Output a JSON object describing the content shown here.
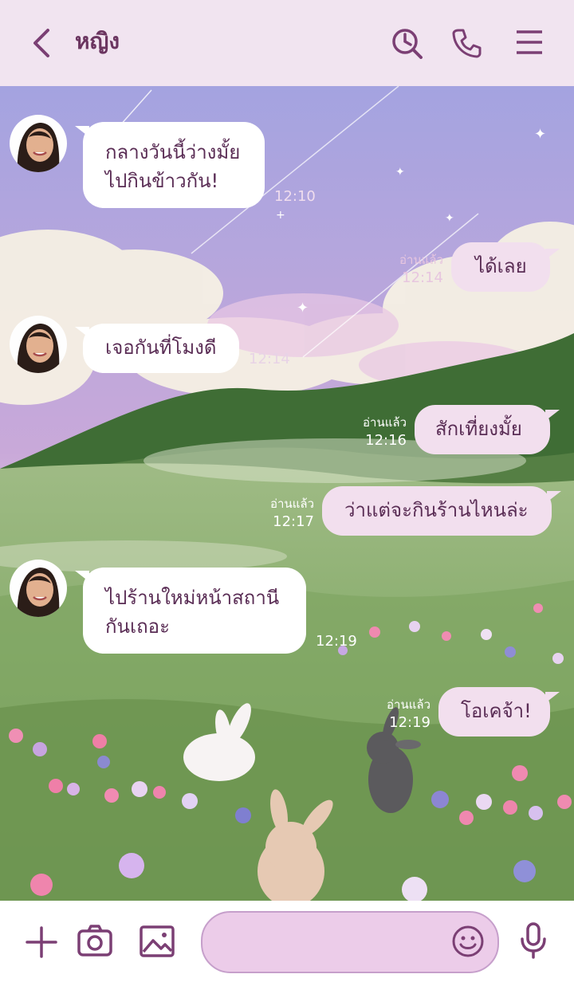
{
  "header": {
    "contact_name": "หญิง"
  },
  "messages": [
    {
      "side": "in",
      "text_lines": [
        "กลางวันนี้ว่างมั้ย",
        "ไปกินข้าวกัน!"
      ],
      "time": "12:10"
    },
    {
      "side": "out",
      "text": "ได้เลย",
      "read_label": "อ่านแล้ว",
      "time": "12:14"
    },
    {
      "side": "in",
      "text": "เจอกันที่โมงดี",
      "time": "12:14"
    },
    {
      "side": "out",
      "text": "สักเที่ยงมั้ย",
      "read_label": "อ่านแล้ว",
      "time": "12:16"
    },
    {
      "side": "out",
      "text": "ว่าแต่จะกินร้านไหนล่ะ",
      "read_label": "อ่านแล้ว",
      "time": "12:17"
    },
    {
      "side": "in",
      "text_lines": [
        "ไปร้านใหม่หน้าสถานี",
        "กันเถอะ"
      ],
      "time": "12:19"
    },
    {
      "side": "out",
      "text": "โอเคจ้า!",
      "read_label": "อ่านแล้ว",
      "time": "12:19"
    }
  ],
  "icons": {
    "back": "chevron-left-icon",
    "history": "clock-search-icon",
    "call": "phone-icon",
    "menu": "hamburger-menu-icon",
    "add": "plus-icon",
    "camera": "camera-icon",
    "gallery": "image-icon",
    "emoji": "smiley-icon",
    "voice": "microphone-icon"
  },
  "colors": {
    "header_bg": "#f1e4f0",
    "accent": "#7b3f74",
    "outgoing_bubble": "#f2dfee",
    "incoming_bubble": "#ffffff",
    "input_bg": "#eccce9"
  }
}
